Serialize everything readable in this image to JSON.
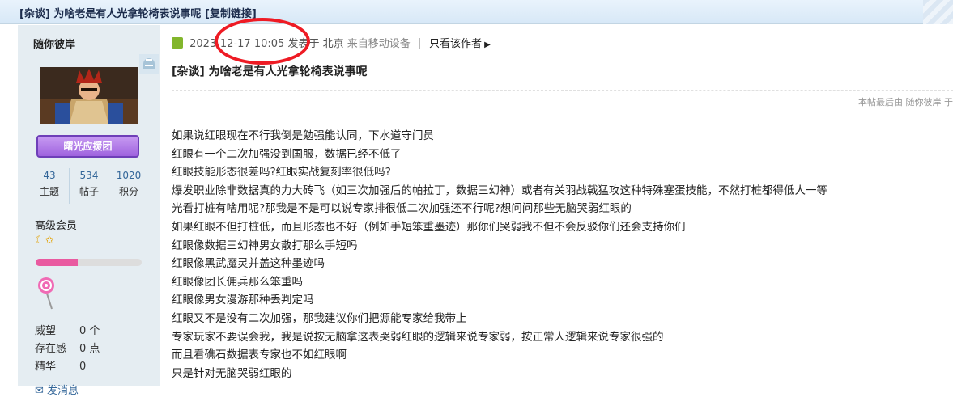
{
  "header": {
    "thread_title": "[杂谈] 为啥老是有人光拿轮椅表说事呢",
    "copy_link": "[复制链接]"
  },
  "author": {
    "name": "随你彼岸",
    "medal": "曙光应援团",
    "stats": [
      {
        "value": "43",
        "label": "主题"
      },
      {
        "value": "534",
        "label": "帖子"
      },
      {
        "value": "1020",
        "label": "积分"
      }
    ],
    "level": "高级会员",
    "level_icons": "☾✩",
    "progress": 0.4,
    "info": [
      {
        "key": "威望",
        "value": "0 个"
      },
      {
        "key": "存在感",
        "value": "0 点"
      },
      {
        "key": "精华",
        "value": "0"
      }
    ],
    "send_message": "发消息"
  },
  "post": {
    "datetime": "2023-12-17 10:05",
    "posted": "发表于",
    "location": "北京",
    "source": "来自移动设备",
    "only_author": "只看该作者",
    "title": "[杂谈] 为啥老是有人光拿轮椅表说事呢",
    "edit_note": "本帖最后由 随你彼岸 于",
    "lines": [
      "如果说红眼现在不行我倒是勉强能认同，下水道守门员",
      "红眼有一个二次加强没到国服，数据已经不低了",
      "红眼技能形态很差吗?红眼实战复刻率很低吗?",
      "爆发职业除非数据真的力大砖飞（如三次加强后的帕拉丁，数据三幻神）或者有关羽战戟猛攻这种特殊塞蛋技能，不然打桩都得低人一等",
      "光看打桩有啥用呢?那我是不是可以说专家排很低二次加强还不行呢?想问问那些无脑哭弱红眼的",
      "如果红眼不但打桩低，而且形态也不好（例如手短笨重墨迹）那你们哭弱我不但不会反驳你们还会支持你们",
      "红眼像数据三幻神男女散打那么手短吗",
      "红眼像黑武魔灵并盖这种墨迹吗",
      "红眼像团长佣兵那么笨重吗",
      "红眼像男女漫游那种丢判定吗",
      "红眼又不是没有二次加强，那我建议你们把源能专家给我带上",
      "专家玩家不要误会我，我是说按无脑拿这表哭弱红眼的逻辑来说专家弱，按正常人逻辑来说专家很强的",
      "而且看礁石数据表专家也不如红眼啊",
      "只是针对无脑哭弱红眼的"
    ]
  },
  "colors": {
    "accent": "#336699",
    "highlight_circle": "#ee1b24",
    "sidebar_bg": "#e5edf2",
    "medal": "#a66ae3",
    "progress": "#e95aa0"
  },
  "icons": [
    "online-icon",
    "poster-icon",
    "candy-badge-icon",
    "chevron-right-icon",
    "mail-icon"
  ]
}
